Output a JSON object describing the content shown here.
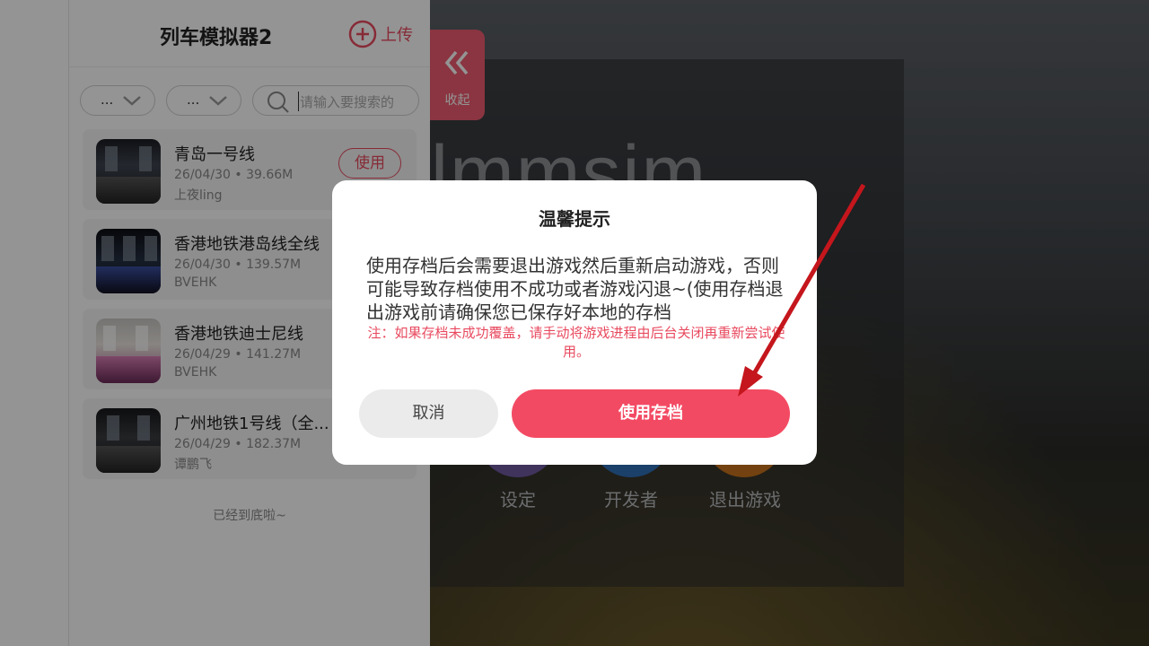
{
  "background": {
    "logo_text": "lmmsim",
    "menu": [
      {
        "label": "设定"
      },
      {
        "label": "开发者"
      },
      {
        "label": "退出游戏"
      }
    ]
  },
  "panel": {
    "title": "列车模拟器2",
    "upload_label": "上传",
    "filter1_value": "...",
    "filter2_value": "...",
    "search_placeholder": "请输入要搜索的",
    "items": [
      {
        "name": "青岛一号线",
        "date": "26/04/30",
        "size": "39.66M",
        "author": "上夜ling",
        "action": "使用"
      },
      {
        "name": "香港地铁港岛线全线",
        "date": "26/04/30",
        "size": "139.57M",
        "author": "BVEHK"
      },
      {
        "name": "香港地铁迪士尼线",
        "date": "26/04/29",
        "size": "141.27M",
        "author": "BVEHK"
      },
      {
        "name": "广州地铁1号线（全...",
        "date": "26/04/29",
        "size": "182.37M",
        "author": "谭鹏飞"
      }
    ],
    "end_note": "已经到底啦~"
  },
  "collapse": {
    "label": "收起"
  },
  "dialog": {
    "title": "温馨提示",
    "body": "使用存档后会需要退出游戏然后重新启动游戏，否则可能导致存档使用不成功或者游戏闪退~(使用存档退出游戏前请确保您已保存好本地的存档",
    "note": "注：如果存档未成功覆盖，请手动将游戏进程由后台关闭再重新尝试使用。",
    "cancel_label": "取消",
    "confirm_label": "使用存档"
  },
  "colors": {
    "accent": "#f34a63",
    "annotation_arrow": "#c4161c"
  }
}
